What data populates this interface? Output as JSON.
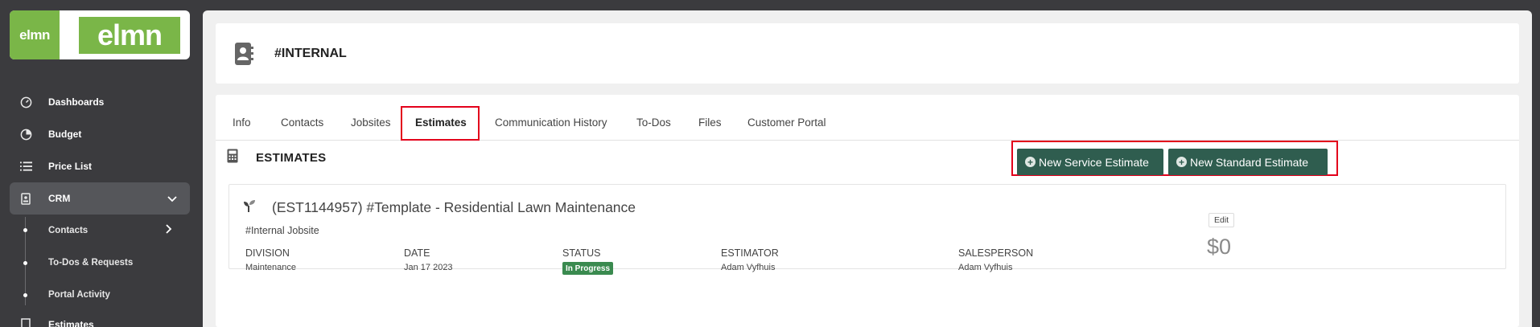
{
  "brand": {
    "logo_small": "elmn",
    "logo_big": "elmn",
    "accent": "#7ab648"
  },
  "sidebar": {
    "items": [
      {
        "label": "Dashboards",
        "icon": "gauge-icon"
      },
      {
        "label": "Budget",
        "icon": "pie-chart-icon"
      },
      {
        "label": "Price List",
        "icon": "list-icon"
      },
      {
        "label": "CRM",
        "icon": "contact-card-icon"
      }
    ],
    "sub_items": [
      {
        "label": "Contacts"
      },
      {
        "label": "To-Dos & Requests"
      },
      {
        "label": "Portal Activity"
      }
    ],
    "next_item": {
      "label": "Estimates"
    }
  },
  "header": {
    "title": "#INTERNAL"
  },
  "tabs": [
    {
      "label": "Info"
    },
    {
      "label": "Contacts"
    },
    {
      "label": "Jobsites"
    },
    {
      "label": "Estimates"
    },
    {
      "label": "Communication History"
    },
    {
      "label": "To-Dos"
    },
    {
      "label": "Files"
    },
    {
      "label": "Customer Portal"
    }
  ],
  "selected_tab": "Estimates",
  "section": {
    "title": "ESTIMATES",
    "buttons": {
      "new_service": "New Service Estimate",
      "new_standard": "New Standard Estimate"
    }
  },
  "estimate": {
    "title": "(EST1144957) #Template - Residential Lawn Maintenance",
    "jobsite": "#Internal Jobsite",
    "columns": {
      "division": {
        "label": "DIVISION",
        "value": "Maintenance"
      },
      "date": {
        "label": "DATE",
        "value": "Jan 17 2023"
      },
      "status": {
        "label": "STATUS",
        "value": "In Progress"
      },
      "estimator": {
        "label": "ESTIMATOR",
        "value": "Adam Vyfhuis"
      },
      "salesperson": {
        "label": "SALESPERSON",
        "value": "Adam Vyfhuis"
      }
    },
    "edit_label": "Edit",
    "amount": "$0"
  },
  "colors": {
    "button": "#2f5d4f",
    "status": "#3a8a4f",
    "highlight": "#e3001b"
  }
}
